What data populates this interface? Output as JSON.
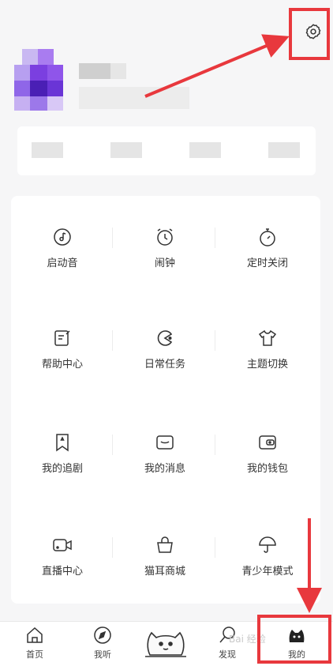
{
  "grid": {
    "items": [
      {
        "label": "启动音",
        "icon": "music-icon"
      },
      {
        "label": "闹钟",
        "icon": "alarm-clock-icon"
      },
      {
        "label": "定时关闭",
        "icon": "timer-icon"
      },
      {
        "label": "帮助中心",
        "icon": "help-edit-icon"
      },
      {
        "label": "日常任务",
        "icon": "task-pacman-icon"
      },
      {
        "label": "主题切换",
        "icon": "tshirt-icon"
      },
      {
        "label": "我的追剧",
        "icon": "bookmark-icon"
      },
      {
        "label": "我的消息",
        "icon": "message-icon"
      },
      {
        "label": "我的钱包",
        "icon": "wallet-icon"
      },
      {
        "label": "直播中心",
        "icon": "video-camera-icon"
      },
      {
        "label": "猫耳商城",
        "icon": "shopping-bag-icon"
      },
      {
        "label": "青少年模式",
        "icon": "umbrella-icon"
      }
    ]
  },
  "nav": {
    "home": "首页",
    "listen": "我听",
    "discover": "发现",
    "mine": "我的"
  },
  "watermark": "Bai 经验",
  "colors": {
    "annotation": "#e8383d",
    "avatar": "#7b3fe0"
  }
}
